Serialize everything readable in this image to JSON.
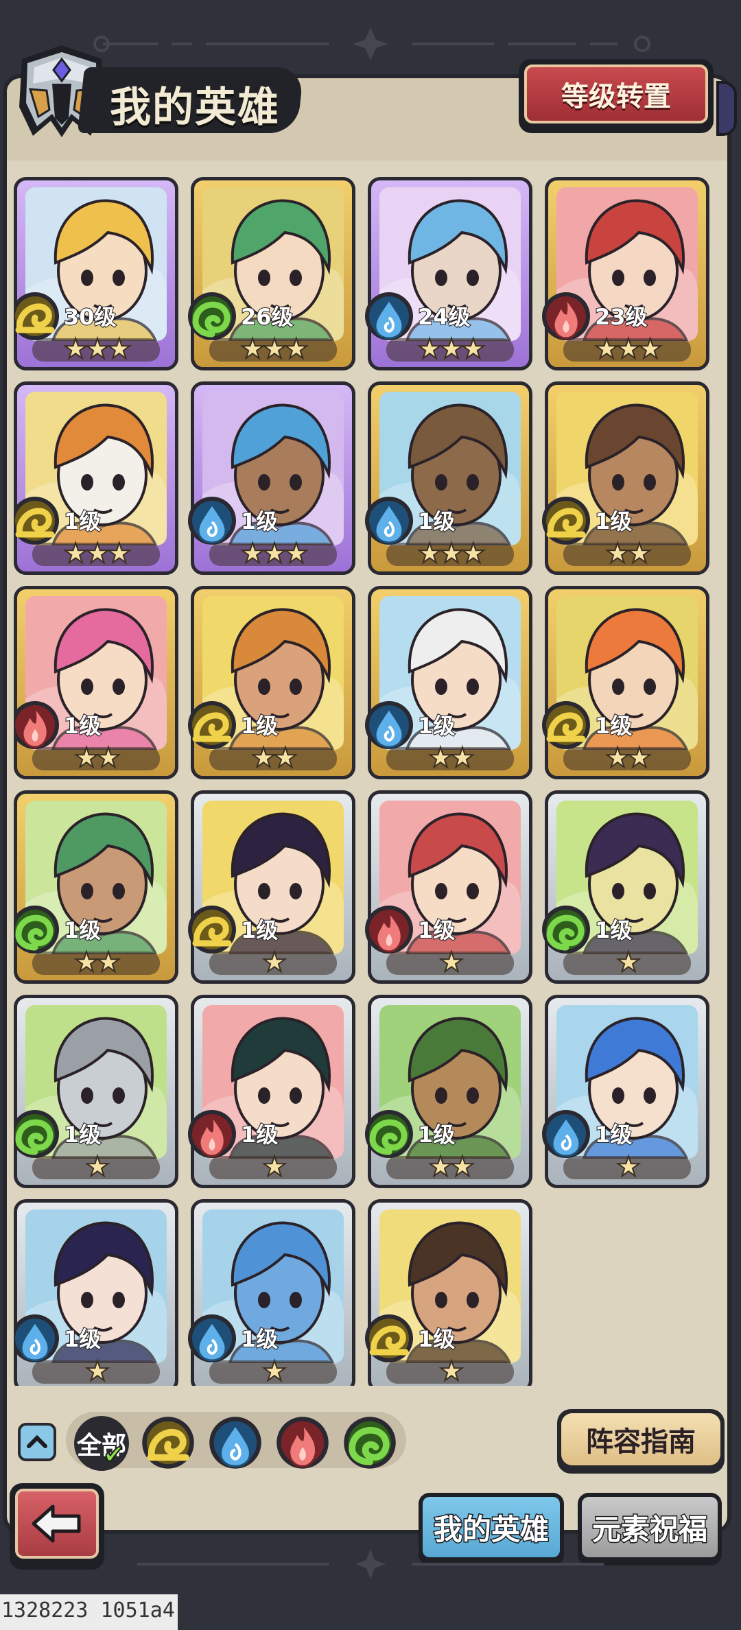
{
  "header": {
    "title": "我的英雄",
    "rank_transfer_label": "等级转置"
  },
  "elements": {
    "earth": {
      "color": "#f0d24a",
      "dark": "#6b5a1a",
      "icon": "earth-swirl-icon"
    },
    "nature": {
      "color": "#7ed84c",
      "dark": "#2d5e1b",
      "icon": "leaf-swirl-icon"
    },
    "water": {
      "color": "#5db0ea",
      "dark": "#1e4f78",
      "icon": "water-drop-icon"
    },
    "fire": {
      "color": "#ef7b7b",
      "dark": "#7a2328",
      "icon": "flame-icon"
    }
  },
  "heroes": [
    {
      "level": "30级",
      "stars": "★★★",
      "element": "earth",
      "frame": "purple",
      "bg": "#cfe3f2",
      "hair": "#f0c04c",
      "skin": "#f6dcc0"
    },
    {
      "level": "26级",
      "stars": "★★★",
      "element": "nature",
      "frame": "gold",
      "bg": "#e7d27a",
      "hair": "#4fa56a",
      "skin": "#f5dac2"
    },
    {
      "level": "24级",
      "stars": "★★★",
      "element": "water",
      "frame": "purple",
      "bg": "#e8d3f4",
      "hair": "#6fb6e4",
      "skin": "#e9d6c7"
    },
    {
      "level": "23级",
      "stars": "★★★",
      "element": "fire",
      "frame": "gold",
      "bg": "#f1a7a7",
      "hair": "#c9433f",
      "skin": "#f5d8c4"
    },
    {
      "level": "1级",
      "stars": "★★★",
      "element": "earth",
      "frame": "purple",
      "bg": "#f0dc8a",
      "hair": "#e08a3a",
      "skin": "#f3f0ea"
    },
    {
      "level": "1级",
      "stars": "★★★",
      "element": "water",
      "frame": "purple",
      "bg": "#d4b9ee",
      "hair": "#4fa1d8",
      "skin": "#a97d5c"
    },
    {
      "level": "1级",
      "stars": "★★★",
      "element": "water",
      "frame": "gold",
      "bg": "#a9d7ea",
      "hair": "#7a5a3c",
      "skin": "#8c6a4a"
    },
    {
      "level": "1级",
      "stars": "★★",
      "element": "earth",
      "frame": "gold",
      "bg": "#f0d66a",
      "hair": "#6a4630",
      "skin": "#b7875f"
    },
    {
      "level": "1级",
      "stars": "★★",
      "element": "fire",
      "frame": "gold",
      "bg": "#f1a9a9",
      "hair": "#e56b9f",
      "skin": "#f6dcc5"
    },
    {
      "level": "1级",
      "stars": "★★",
      "element": "earth",
      "frame": "gold",
      "bg": "#f0d86a",
      "hair": "#d88a3a",
      "skin": "#d9a27a"
    },
    {
      "level": "1级",
      "stars": "★★",
      "element": "water",
      "frame": "gold",
      "bg": "#b6dcef",
      "hair": "#eeeeee",
      "skin": "#f5dcc6"
    },
    {
      "level": "1级",
      "stars": "★★",
      "element": "earth",
      "frame": "gold",
      "bg": "#e6d56a",
      "hair": "#ec7a3c",
      "skin": "#f3d6b9"
    },
    {
      "level": "1级",
      "stars": "★★",
      "element": "nature",
      "frame": "gold",
      "bg": "#cbe69a",
      "hair": "#4e9a62",
      "skin": "#c99a76"
    },
    {
      "level": "1级",
      "stars": "★",
      "element": "earth",
      "frame": "silver",
      "bg": "#f0d96a",
      "hair": "#2d2240",
      "skin": "#f4dcc9"
    },
    {
      "level": "1级",
      "stars": "★",
      "element": "fire",
      "frame": "silver",
      "bg": "#f1a9a9",
      "hair": "#c84a4a",
      "skin": "#f6dcc5"
    },
    {
      "level": "1级",
      "stars": "★",
      "element": "nature",
      "frame": "silver",
      "bg": "#c7e48a",
      "hair": "#3a2c52",
      "skin": "#e9e2a0"
    },
    {
      "level": "1级",
      "stars": "★",
      "element": "nature",
      "frame": "silver",
      "bg": "#bfe08a",
      "hair": "#9aa0a6",
      "skin": "#c9ced2"
    },
    {
      "level": "1级",
      "stars": "★",
      "element": "fire",
      "frame": "silver",
      "bg": "#f1a9a9",
      "hair": "#1f3b3a",
      "skin": "#f4dcc8"
    },
    {
      "level": "1级",
      "stars": "★★",
      "element": "nature",
      "frame": "silver",
      "bg": "#9fd27a",
      "hair": "#4a7a3a",
      "skin": "#b58a5a"
    },
    {
      "level": "1级",
      "stars": "★",
      "element": "water",
      "frame": "silver",
      "bg": "#a9d6ec",
      "hair": "#3f7bd6",
      "skin": "#f5dfcd"
    },
    {
      "level": "1级",
      "stars": "★",
      "element": "water",
      "frame": "silver",
      "bg": "#a6d3ea",
      "hair": "#2a2450",
      "skin": "#f4e0d4"
    },
    {
      "level": "1级",
      "stars": "★",
      "element": "water",
      "frame": "silver",
      "bg": "#a6d3ea",
      "hair": "#4f93d6",
      "skin": "#6fa9df"
    },
    {
      "level": "1级",
      "stars": "★",
      "element": "earth",
      "frame": "silver",
      "bg": "#f0dc7a",
      "hair": "#4a3426",
      "skin": "#d6a47e"
    }
  ],
  "filters": {
    "all_label": "全部",
    "elements": [
      "earth",
      "water",
      "fire",
      "nature"
    ]
  },
  "guide_label": "阵容指南",
  "tabs": {
    "my_heroes": "我的英雄",
    "element_blessing": "元素祝福"
  },
  "debug_text": "1328223 1051a4"
}
